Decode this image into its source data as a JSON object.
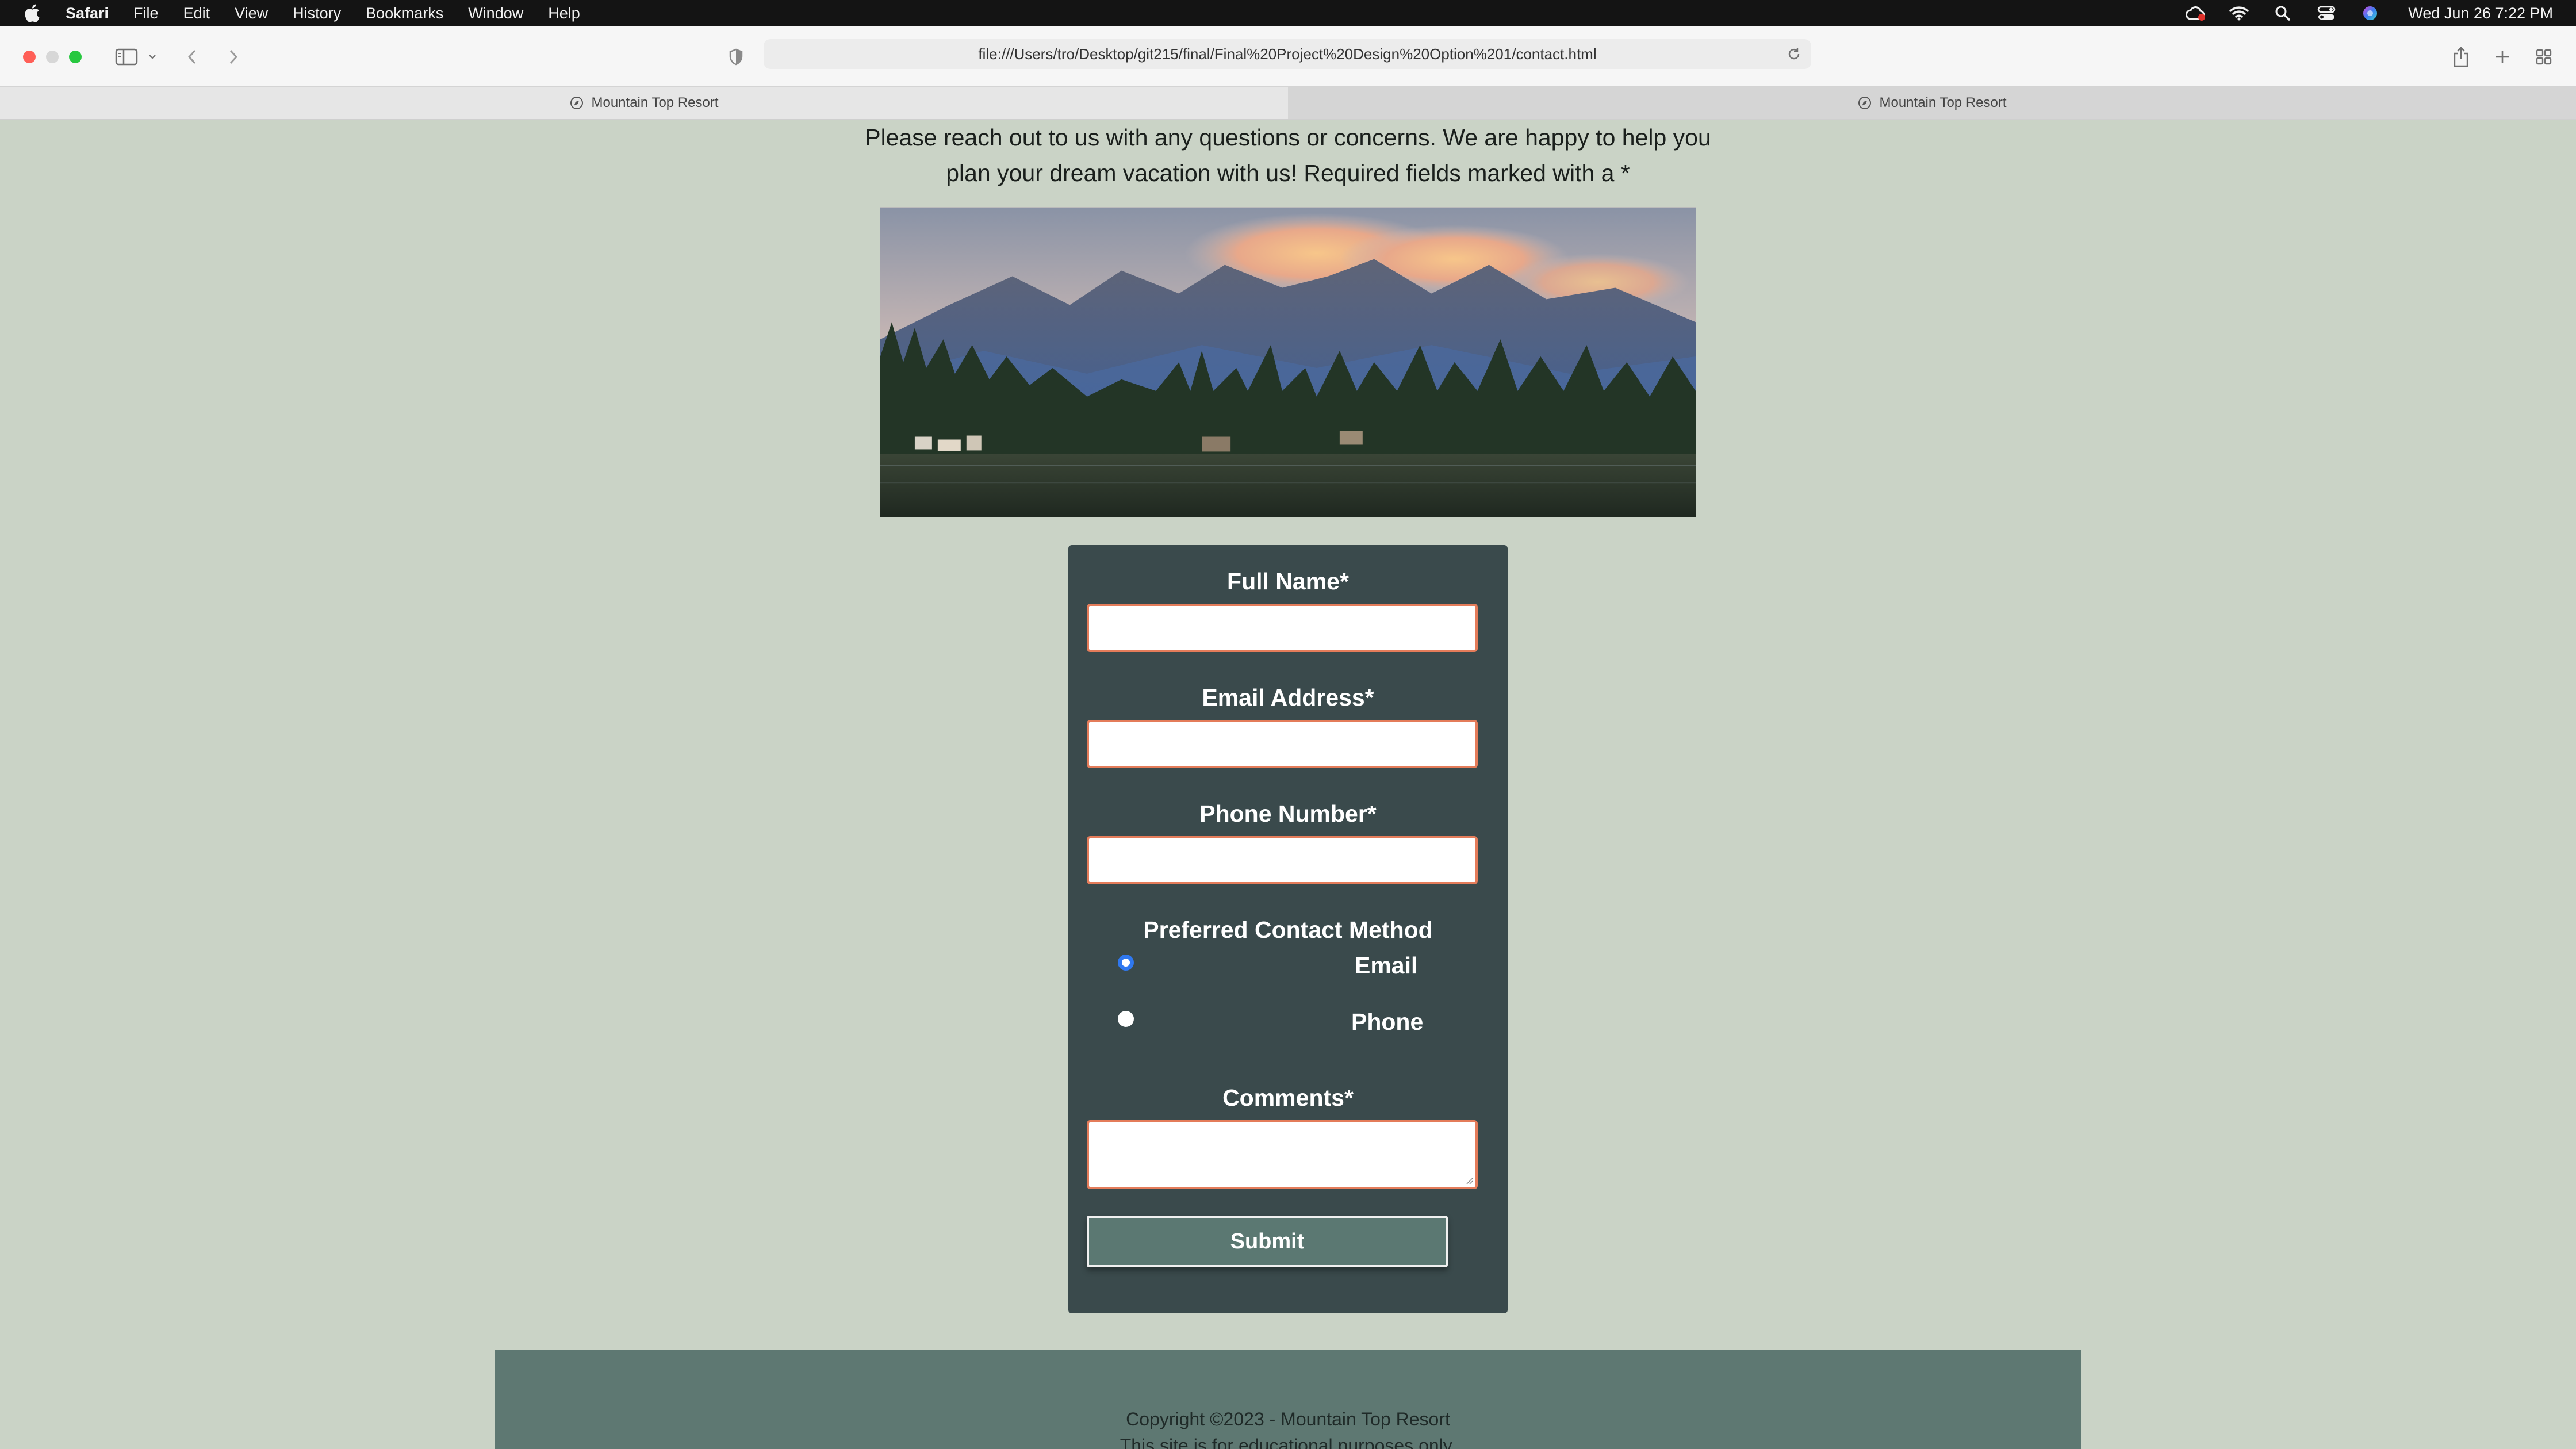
{
  "menubar": {
    "app_name": "Safari",
    "items": [
      "File",
      "Edit",
      "View",
      "History",
      "Bookmarks",
      "Window",
      "Help"
    ],
    "clock": "Wed Jun 26  7:22 PM",
    "status_icons": [
      "creative-cloud-icon",
      "wifi-icon",
      "spotlight-search-icon",
      "control-center-icon",
      "siri-icon"
    ]
  },
  "browser": {
    "url": "file:///Users/tro/Desktop/git215/final/Final%20Project%20Design%20Option%201/contact.html",
    "tabs": [
      {
        "title": "Mountain Top Resort",
        "active": false
      },
      {
        "title": "Mountain Top Resort",
        "active": true
      }
    ]
  },
  "page": {
    "intro": "Please reach out to us with any questions or concerns. We are happy to help you plan your dream vacation with us! Required fields marked with a *",
    "form": {
      "full_name_label": "Full Name*",
      "email_label": "Email Address*",
      "phone_label": "Phone Number*",
      "contact_method_label": "Preferred Contact Method",
      "radio_options": [
        {
          "label": "Email",
          "checked": true
        },
        {
          "label": "Phone",
          "checked": false
        }
      ],
      "comments_label": "Comments*",
      "submit_label": "Submit"
    },
    "footer": {
      "copyright": "Copyright ©2023 - Mountain Top Resort",
      "disclaimer": "This site is for educational purposes only."
    }
  },
  "colors": {
    "page_background": "#cad3c6",
    "form_background": "#3a4a4c",
    "input_border": "#e47c5a",
    "submit_background": "#5b7872",
    "footer_background": "#5e7872",
    "radio_selected": "#2f78f0"
  }
}
